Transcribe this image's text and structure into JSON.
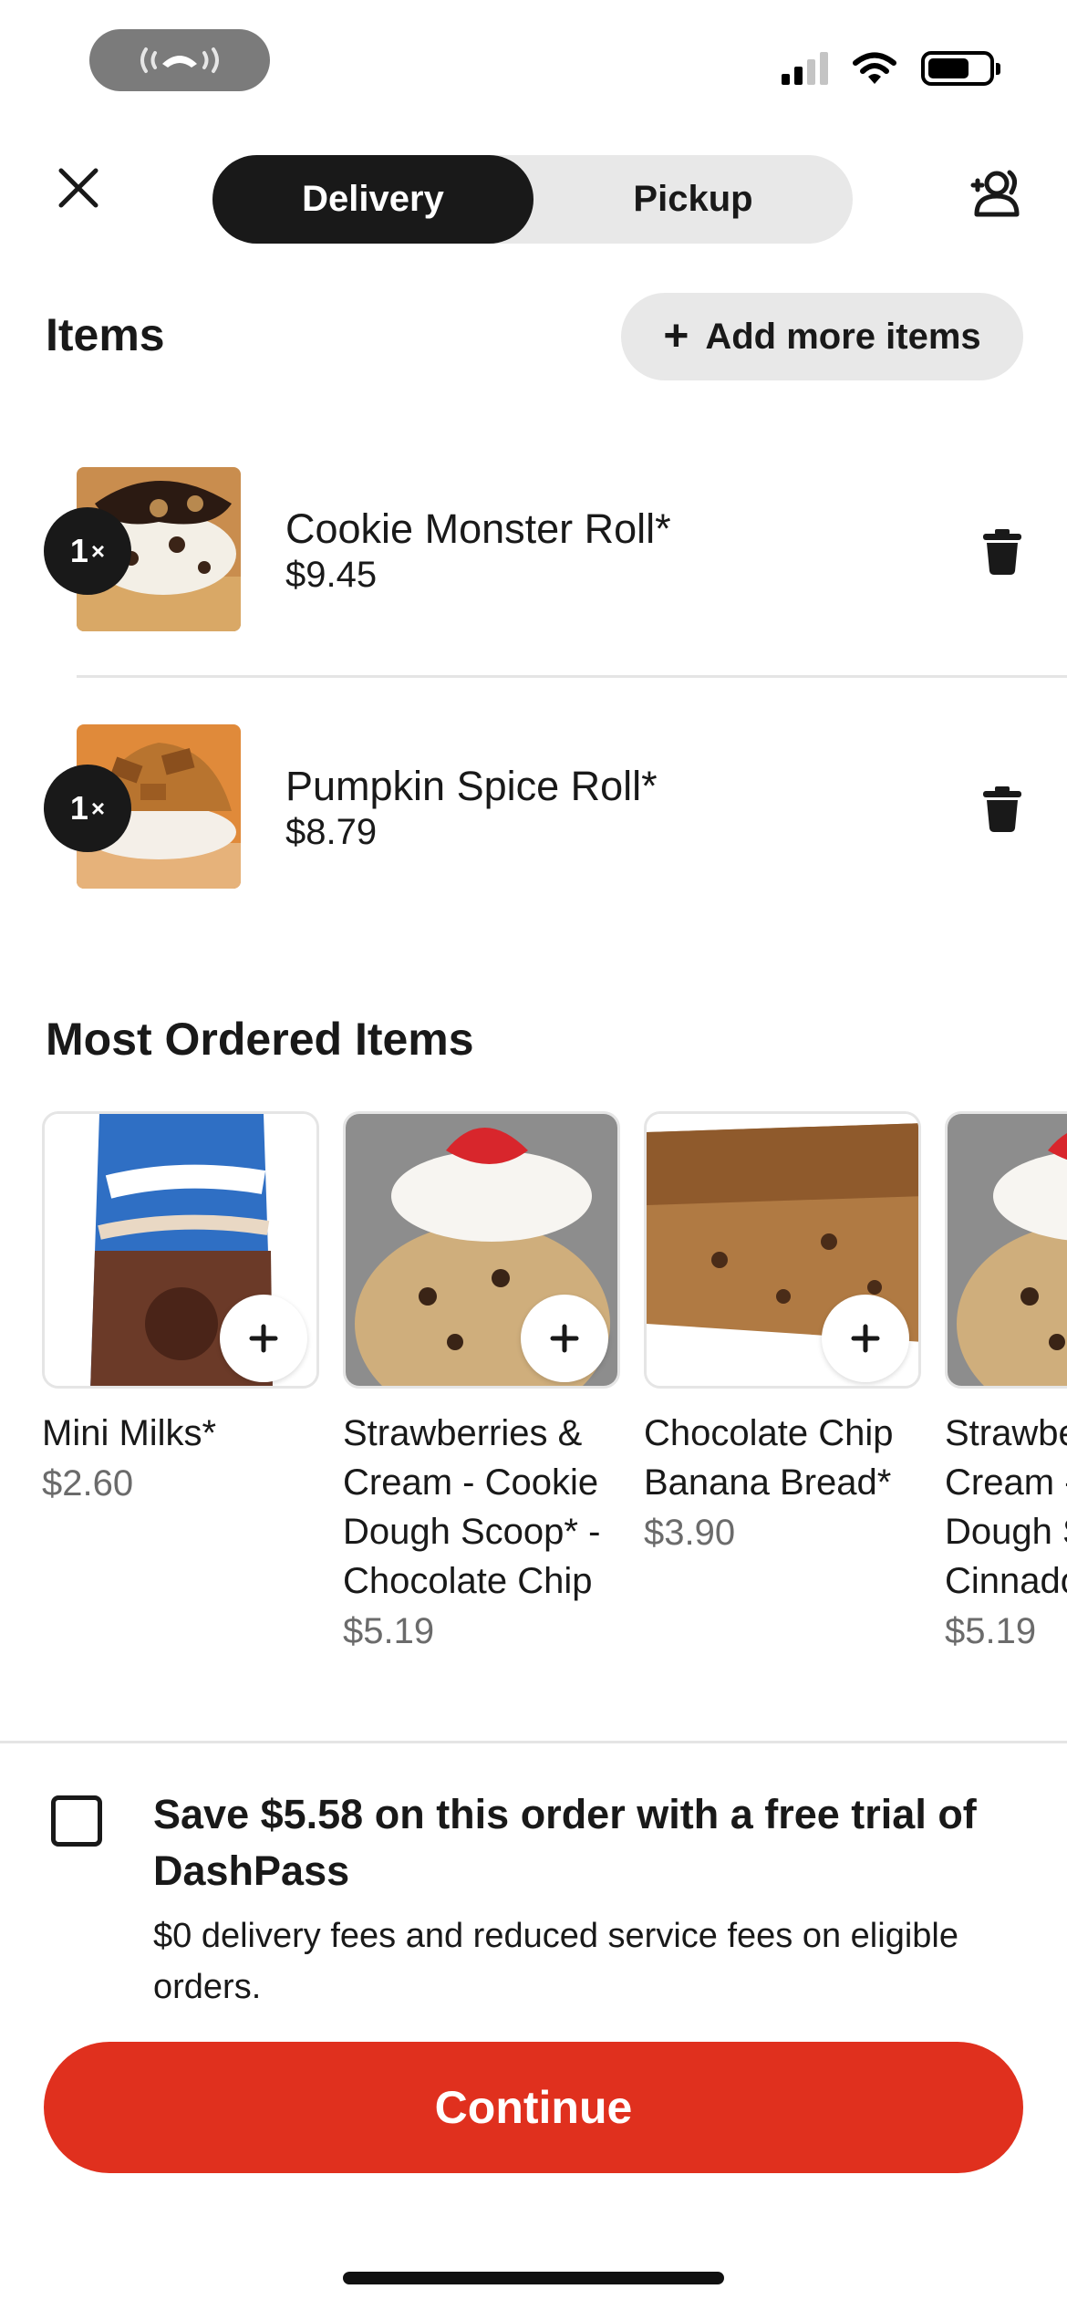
{
  "header": {
    "toggle": [
      {
        "label": "Delivery",
        "active": true
      },
      {
        "label": "Pickup",
        "active": false
      }
    ],
    "close_icon": "close-icon",
    "group_icon": "group-order-icon"
  },
  "items_section": {
    "title": "Items",
    "add_more_label": "Add more items",
    "items": [
      {
        "qty": "1",
        "qty_suffix": "×",
        "name": "Cookie Monster Roll*",
        "price": "$9.45"
      },
      {
        "qty": "1",
        "qty_suffix": "×",
        "name": "Pumpkin Spice Roll*",
        "price": "$8.79"
      }
    ]
  },
  "most_ordered": {
    "title": "Most Ordered Items",
    "items": [
      {
        "name": "Mini Milks*",
        "price": "$2.60"
      },
      {
        "name": "Strawberries & Cream - Cookie Dough Scoop* - Chocolate Chip",
        "price": "$5.19"
      },
      {
        "name": "Chocolate Chip Banana Bread*",
        "price": "$3.90"
      },
      {
        "name": "Strawberries & Cream - Cookie Dough Scoop* - Cinnadoodle",
        "price": "$5.19"
      }
    ]
  },
  "dashpass": {
    "title": "Save $5.58 on this order with a free trial of DashPass",
    "description": "$0 delivery fees and reduced service fees on eligible orders."
  },
  "continue_label": "Continue",
  "colors": {
    "accent": "#e0301e",
    "dark": "#191919",
    "pill_bg": "#e8e8e8"
  }
}
